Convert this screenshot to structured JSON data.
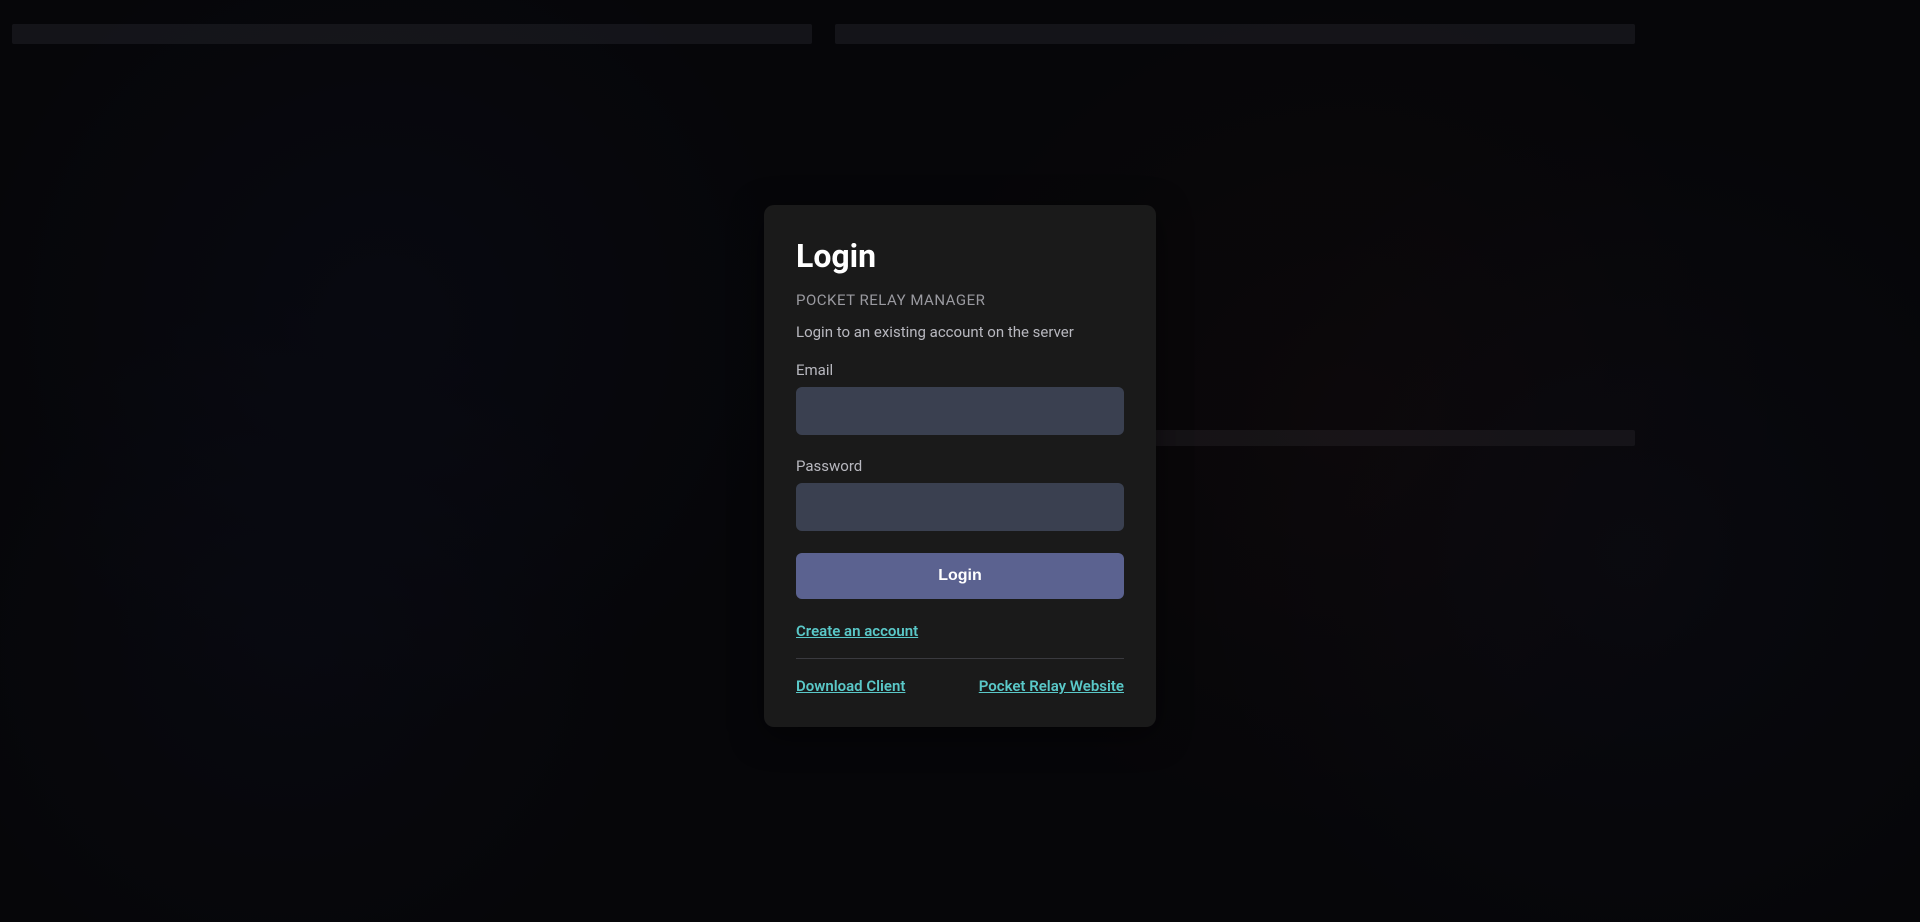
{
  "login": {
    "title": "Login",
    "subtitle": "POCKET RELAY MANAGER",
    "description": "Login to an existing account on the server",
    "email_label": "Email",
    "password_label": "Password",
    "button_label": "Login",
    "create_account_link": "Create an account",
    "download_client_link": "Download Client",
    "website_link": "Pocket Relay Website"
  }
}
